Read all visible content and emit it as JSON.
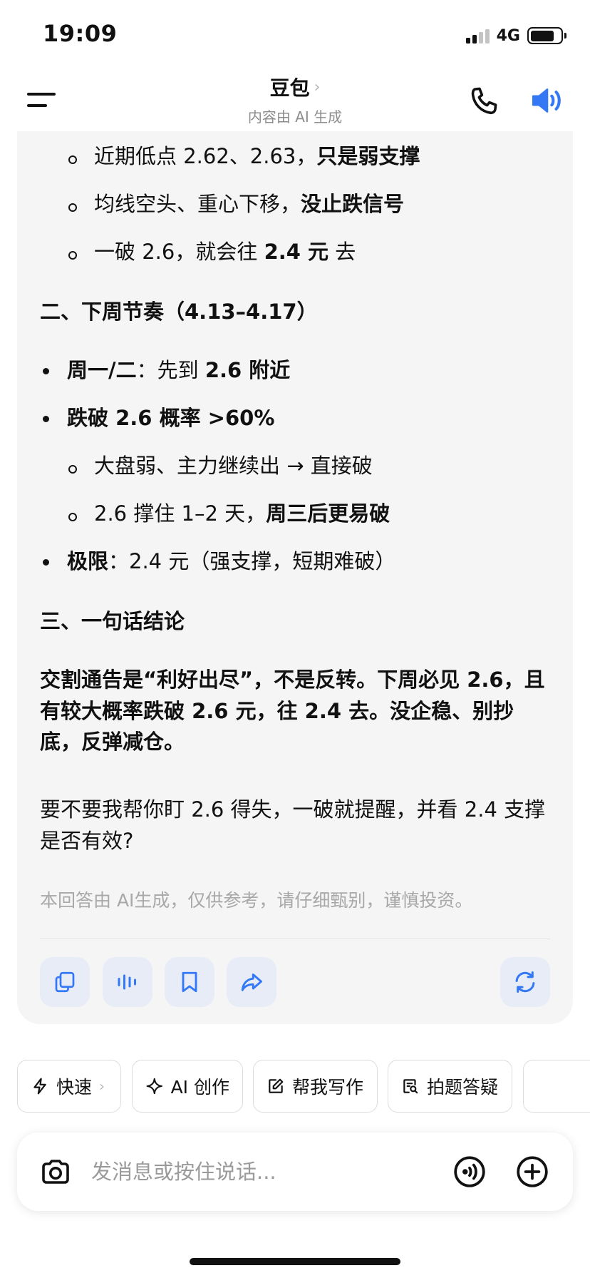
{
  "status_bar": {
    "time": "19:09",
    "network": "4G",
    "battery_level": 0.8
  },
  "header": {
    "title": "豆包",
    "title_chevron": "›",
    "subtitle": "内容由 AI 生成",
    "menu_icon": "hamburger-menu-icon",
    "phone_icon": "phone-icon",
    "speaker_icon": "speaker-icon",
    "accent_color": "#3478f6"
  },
  "message": {
    "items": [
      {
        "normal": "近期低点 2.62、2.63，",
        "bold": "只是弱支撑"
      },
      {
        "normal": "均线空头、重心下移，",
        "bold": "没止跌信号"
      },
      {
        "pre": "一破 2.6，就会往 ",
        "bold": "2.4 元",
        "post": " 去"
      }
    ],
    "section2_heading": "二、下周节奏（4.13–4.17）",
    "section2_bullets": [
      {
        "bold": "周一/二",
        "normal": "：先到 ",
        "bold2": "2.6 附近"
      },
      {
        "bold": "跌破 2.6 概率 >60%"
      },
      {
        "sub": "大盘弱、主力继续出 → 直接破"
      },
      {
        "sub_normal": "2.6 撑住 1–2 天，",
        "sub_bold": "周三后更易破"
      },
      {
        "bold": "极限",
        "normal": "：2.4 元（强支撑，短期难破）"
      }
    ],
    "section3_heading": "三、一句话结论",
    "conclusion": "交割通告是“利好出尽”，不是反转。下周必见 2.6，且有较大概率跌破 2.6 元，往 2.4 去。没企稳、别抄底，反弹减仓。",
    "followup": "要不要我帮你盯 2.6 得失，一破就提醒，并看 2.4 支撑是否有效?",
    "disclaimer": "本回答由 AI生成，仅供参考，请仔细甄别，谨慎投资。",
    "actions": [
      "copy-icon",
      "voice-playback-icon",
      "bookmark-icon",
      "share-icon",
      "regenerate-icon"
    ]
  },
  "quick_chips": [
    {
      "label": "快速",
      "icon": "lightning-icon",
      "chevron": "›"
    },
    {
      "label": "AI 创作",
      "icon": "sparkle-icon"
    },
    {
      "label": "帮我写作",
      "icon": "edit-icon"
    },
    {
      "label": "拍题答疑",
      "icon": "photo-question-icon"
    }
  ],
  "input": {
    "placeholder": "发消息或按住说话...",
    "camera_icon": "camera-icon",
    "voice_icon": "voice-call-icon",
    "plus_icon": "plus-icon"
  }
}
